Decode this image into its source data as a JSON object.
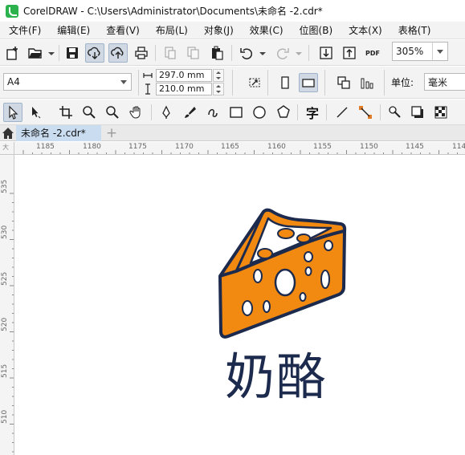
{
  "window": {
    "title": "CorelDRAW - C:\\Users\\Administrator\\Documents\\未命名 -2.cdr*"
  },
  "menubar": {
    "items": [
      {
        "label": "文件(F)"
      },
      {
        "label": "编辑(E)"
      },
      {
        "label": "查看(V)"
      },
      {
        "label": "布局(L)"
      },
      {
        "label": "对象(J)"
      },
      {
        "label": "效果(C)"
      },
      {
        "label": "位图(B)"
      },
      {
        "label": "文本(X)"
      },
      {
        "label": "表格(T)"
      }
    ]
  },
  "toolbar": {
    "zoom_value": "305%",
    "icons": [
      "new-document-icon",
      "open-folder-icon",
      "save-icon",
      "cloud-import-icon",
      "cloud-export-icon",
      "print-icon",
      "cut-icon",
      "copy-icon",
      "paste-icon",
      "undo-icon",
      "redo-icon",
      "import-icon",
      "export-icon",
      "publish-pdf-icon"
    ],
    "pdf_label": "PDF"
  },
  "property_bar": {
    "page_size": "A4",
    "width": "297.0 mm",
    "height": "210.0 mm",
    "units_label": "单位:",
    "units_value": "毫米"
  },
  "tools": [
    "pick-tool-icon",
    "shape-tool-icon",
    "crop-tool-icon",
    "zoom-tool-icon",
    "pan-tool-icon",
    "pen-tool-icon",
    "brush-tool-icon",
    "spiral-tool-icon",
    "rectangle-tool-icon",
    "ellipse-tool-icon",
    "polygon-tool-icon",
    "text-tool-icon",
    "line-tool-icon",
    "connector-tool-icon",
    "eyedropper-tool-icon",
    "shadow-tool-icon",
    "transparency-tool-icon"
  ],
  "text_tool_glyph": "字",
  "tabs": {
    "document": "未命名 -2.cdr*",
    "new_tab": "+"
  },
  "rulers": {
    "horizontal": [
      "1185",
      "1180",
      "1175",
      "1170",
      "1165",
      "1160",
      "1155",
      "1150",
      "1145",
      "114"
    ],
    "vertical": [
      "535",
      "530",
      "525",
      "520",
      "515",
      "510"
    ],
    "corner_mark": "大"
  },
  "canvas": {
    "caption": "奶酪",
    "colors": {
      "cheese_fill": "#f28a12",
      "outline": "#1c2a4d",
      "caption": "#1c2a4d"
    }
  }
}
